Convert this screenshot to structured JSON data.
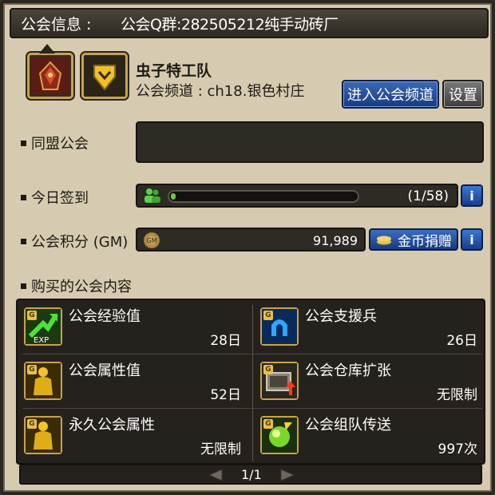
{
  "header": {
    "label": "公会信息 :",
    "qq_group": "公会Q群:282505212纯手动砖厂"
  },
  "guild": {
    "name": "虫子特工队",
    "channel": "公会频道 : ch18.银色村庄",
    "enter_channel_button": "进入公会频道",
    "settings_button": "设置"
  },
  "alliance": {
    "label": "同盟公会"
  },
  "signin": {
    "label": "今日签到",
    "count": "(1/58)",
    "progress_fraction": 0.0172
  },
  "points": {
    "label": "公会积分 (GM)",
    "value": "91,989",
    "donate_button": "金币捐赠",
    "coin_text": "GM"
  },
  "info_button": "i",
  "purchased": {
    "label": "购买的公会内容",
    "items": [
      {
        "name": "公会经验值",
        "duration": "28日",
        "icon": "exp-icon"
      },
      {
        "name": "公会支援兵",
        "duration": "26日",
        "icon": "support-soldier-icon"
      },
      {
        "name": "公会属性值",
        "duration": "52日",
        "icon": "golden-body-icon"
      },
      {
        "name": "公会仓库扩张",
        "duration": "无限制",
        "icon": "storage-expand-icon"
      },
      {
        "name": "永久公会属性",
        "duration": "无限制",
        "icon": "golden-body-icon"
      },
      {
        "name": "公会组队传送",
        "duration": "997次",
        "icon": "teleport-orb-icon"
      }
    ],
    "badge": "G",
    "exp_text": "EXP"
  },
  "pager": {
    "page": "1/1"
  },
  "colors": {
    "accent_blue": "#2a56a8",
    "progress_green": "#6dc93b",
    "gold_border": "#c9a34b"
  }
}
